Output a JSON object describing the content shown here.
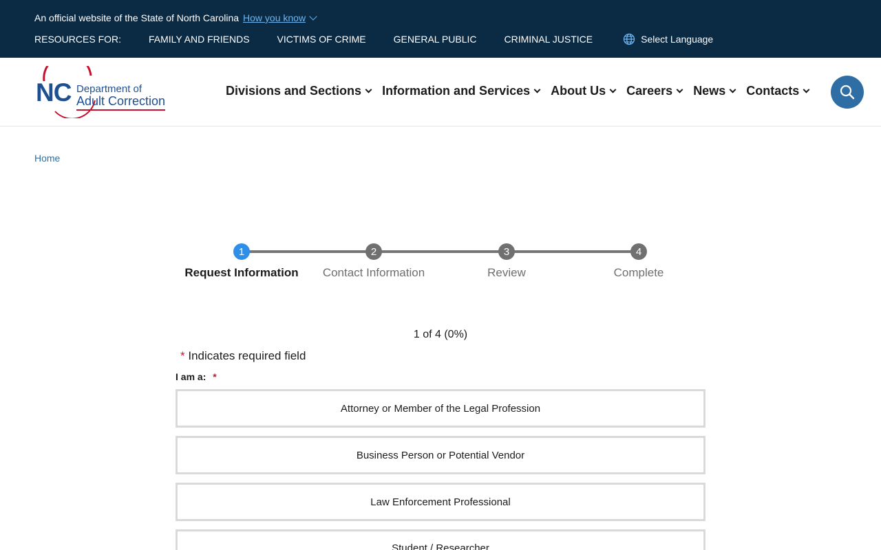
{
  "banner": {
    "official_text": "An official website of the State of North Carolina",
    "how_know": "How you know",
    "resources_label": "RESOURCES FOR:",
    "resources": [
      "FAMILY AND FRIENDS",
      "VICTIMS OF CRIME",
      "GENERAL PUBLIC",
      "CRIMINAL JUSTICE"
    ],
    "language": "Select Language"
  },
  "logo": {
    "abbr": "NC",
    "line1": "Department of",
    "line2": "Adult Correction"
  },
  "nav": [
    "Divisions and Sections",
    "Information and Services",
    "About Us",
    "Careers",
    "News",
    "Contacts"
  ],
  "breadcrumb": "Home",
  "steps": [
    {
      "num": "1",
      "label": "Request Information"
    },
    {
      "num": "2",
      "label": "Contact Information"
    },
    {
      "num": "3",
      "label": "Review"
    },
    {
      "num": "4",
      "label": "Complete"
    }
  ],
  "form": {
    "progress": "1 of 4 (0%)",
    "required_asterisk": "*",
    "required_note": "Indicates required field",
    "iam_label": "I am a:",
    "options": [
      "Attorney or Member of the Legal Profession",
      "Business Person or Potential Vendor",
      "Law Enforcement Professional",
      "Student / Researcher"
    ]
  },
  "colors": {
    "banner_bg": "#0b2a43",
    "brand_blue": "#1d4f91",
    "brand_red": "#c8102e",
    "active_step": "#2e8ee8",
    "search_button": "#2e6ea5"
  }
}
